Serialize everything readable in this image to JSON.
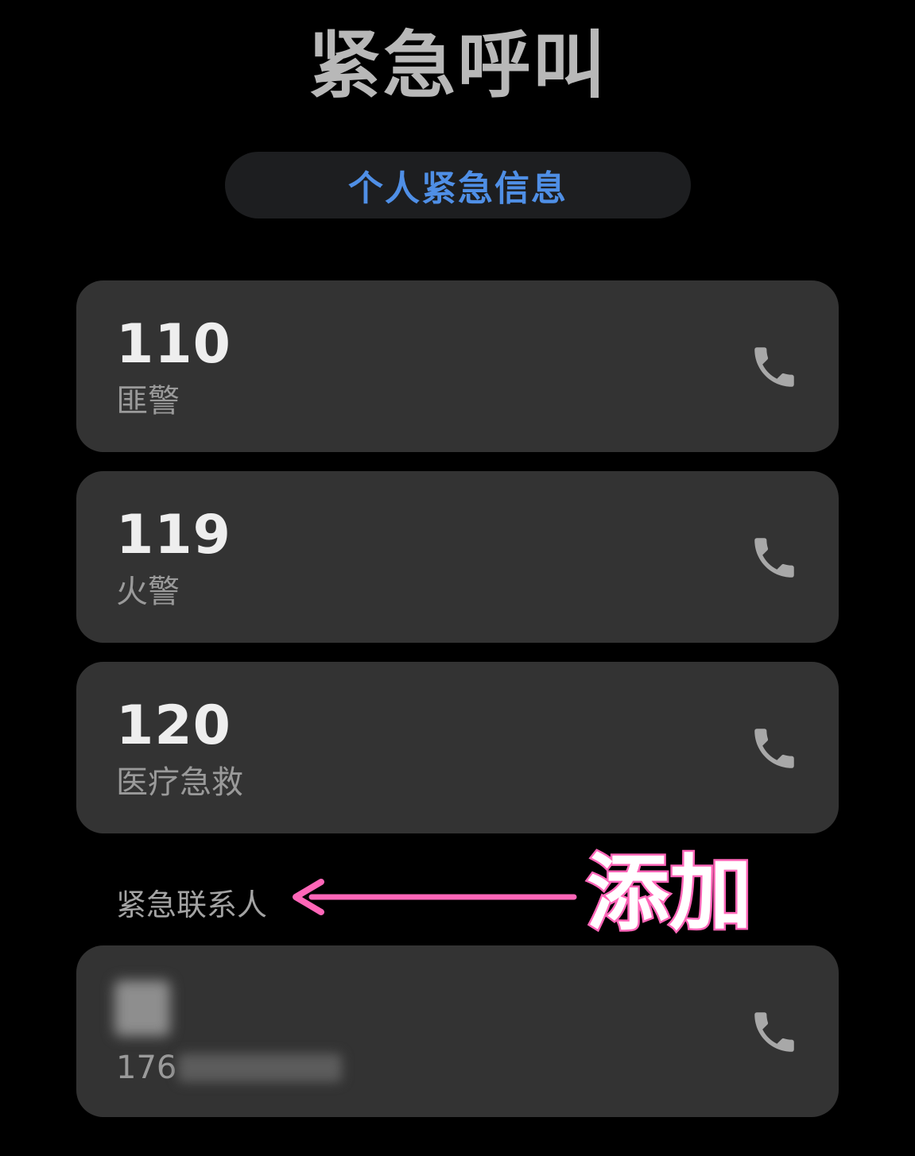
{
  "header": {
    "title": "紧急呼叫",
    "info_button_label": "个人紧急信息"
  },
  "emergency_numbers": [
    {
      "number": "110",
      "label": "匪警",
      "icon": "phone-icon"
    },
    {
      "number": "119",
      "label": "火警",
      "icon": "phone-icon"
    },
    {
      "number": "120",
      "label": "医疗急救",
      "icon": "phone-icon"
    }
  ],
  "contacts_section": {
    "title": "紧急联系人",
    "annotation": "添加",
    "contacts": [
      {
        "phone_prefix": "176",
        "icon": "phone-icon"
      }
    ]
  },
  "colors": {
    "background": "#000000",
    "card": "#333333",
    "accent": "#4f8fe6",
    "annotation": "#ff66b8"
  }
}
